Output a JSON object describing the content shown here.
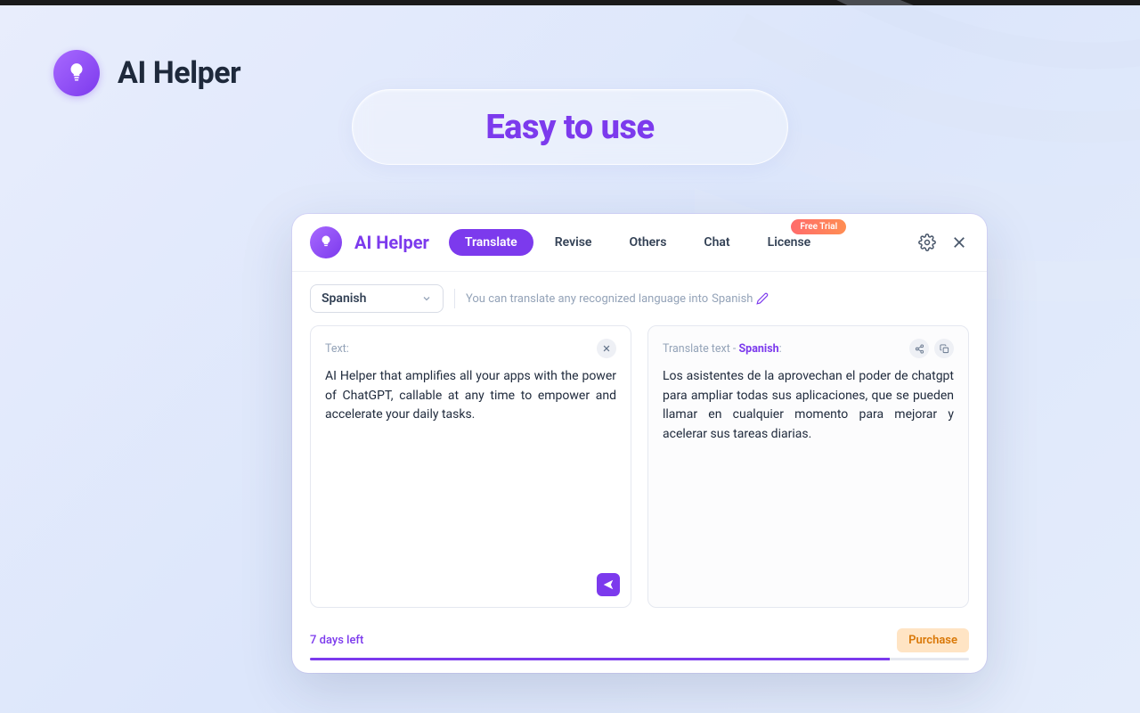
{
  "outer": {
    "title": "AI Helper",
    "tagline": "Easy to use"
  },
  "app": {
    "title": "AI Helper",
    "tabs": [
      {
        "label": "Translate",
        "active": true
      },
      {
        "label": "Revise",
        "active": false
      },
      {
        "label": "Others",
        "active": false
      },
      {
        "label": "Chat",
        "active": false
      },
      {
        "label": "License",
        "active": false,
        "badge": "Free Trial"
      }
    ],
    "language": {
      "selected": "Spanish",
      "hint_prefix": "You can translate any recognized language into ",
      "hint_lang": "Spanish"
    },
    "left_pane": {
      "label": "Text:",
      "content": "AI Helper that amplifies all your apps with the power of ChatGPT, callable at any time to empower and accelerate your daily tasks."
    },
    "right_pane": {
      "label_prefix": "Translate text - ",
      "label_lang": "Spanish",
      "label_suffix": ":",
      "content": "Los asistentes de la aprovechan el poder de chatgpt para ampliar todas sus aplicaciones, que se pueden llamar en cualquier momento para mejorar y acelerar sus tareas diarias."
    },
    "footer": {
      "days_left": "7 days left",
      "purchase": "Purchase"
    }
  }
}
